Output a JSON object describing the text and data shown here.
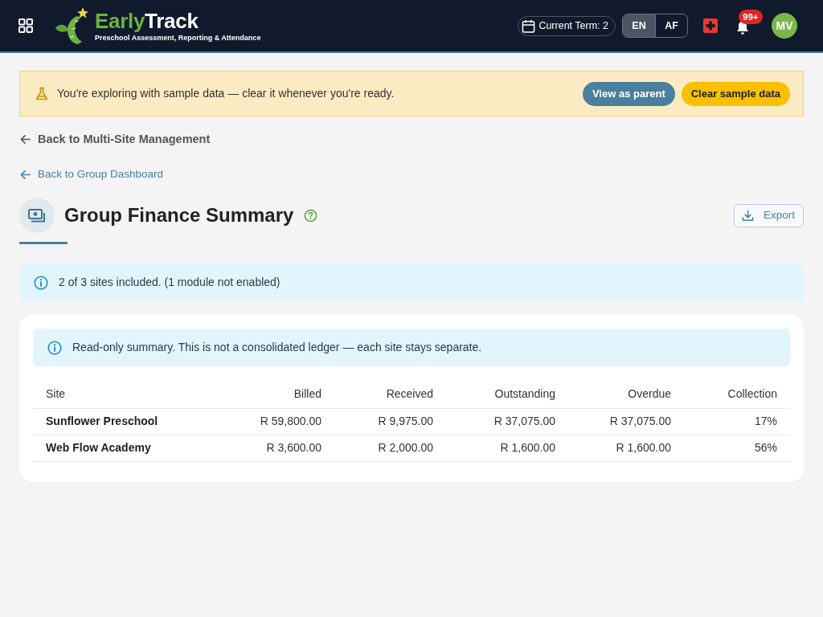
{
  "header": {
    "logo": {
      "word_1": "Early",
      "word_2": "Track",
      "tagline": "Preschool Assessment, Reporting & Attendance"
    },
    "term": "Current Term: 2",
    "languages": [
      {
        "label": "EN",
        "selected": true
      },
      {
        "label": "AF",
        "selected": false
      }
    ],
    "notifications_badge": "99+",
    "avatar": "MV"
  },
  "banner": {
    "message": "You're exploring with sample data — clear it whenever you're ready.",
    "buttons": [
      {
        "label": "View as parent",
        "kind": "secondary"
      },
      {
        "label": "Clear sample data",
        "kind": "warning"
      }
    ]
  },
  "back_links": [
    {
      "label": "Back to Multi-Site Management",
      "kind": "muted"
    },
    {
      "label": "Back to Group Dashboard",
      "kind": "primary"
    }
  ],
  "page": {
    "title": "Group Finance Summary",
    "export_button": "Export"
  },
  "notice": "2 of 3 sites included. (1 module not enabled)",
  "summary": {
    "notice": "Read-only summary. This is not a consolidated ledger — each site stays separate.",
    "table": {
      "columns": [
        "Site",
        "Billed",
        "Received",
        "Outstanding",
        "Overdue",
        "Collection"
      ],
      "rows": [
        [
          "Sunflower Preschool",
          "R 59,800.00",
          "R 9,975.00",
          "R 37,075.00",
          "R 37,075.00",
          "17%"
        ],
        [
          "Web Flow Academy",
          "R 3,600.00",
          "R 2,000.00",
          "R 1,600.00",
          "R 1,600.00",
          "56%"
        ]
      ]
    }
  }
}
